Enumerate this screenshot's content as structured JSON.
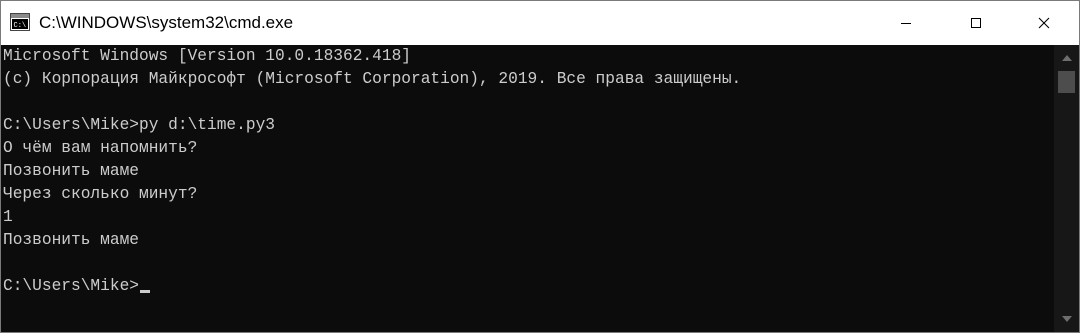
{
  "window": {
    "title": "C:\\WINDOWS\\system32\\cmd.exe",
    "icon": "cmd-icon",
    "buttons": {
      "minimize": "minimize-icon",
      "maximize": "maximize-icon",
      "close": "close-icon"
    }
  },
  "console": {
    "background_color": "#0c0c0c",
    "text_color": "#cccccc",
    "lines": [
      "Microsoft Windows [Version 10.0.18362.418]",
      "(c) Корпорация Майкрософт (Microsoft Corporation), 2019. Все права защищены.",
      "",
      "C:\\Users\\Mike>py d:\\time.py3",
      "О чём вам напомнить?",
      "Позвонить маме",
      "Через сколько минут?",
      "1",
      "Позвонить маме",
      "",
      "C:\\Users\\Mike>"
    ]
  },
  "scrollbar": {
    "up_icon": "scroll-up-arrow-icon",
    "down_icon": "scroll-down-arrow-icon"
  }
}
